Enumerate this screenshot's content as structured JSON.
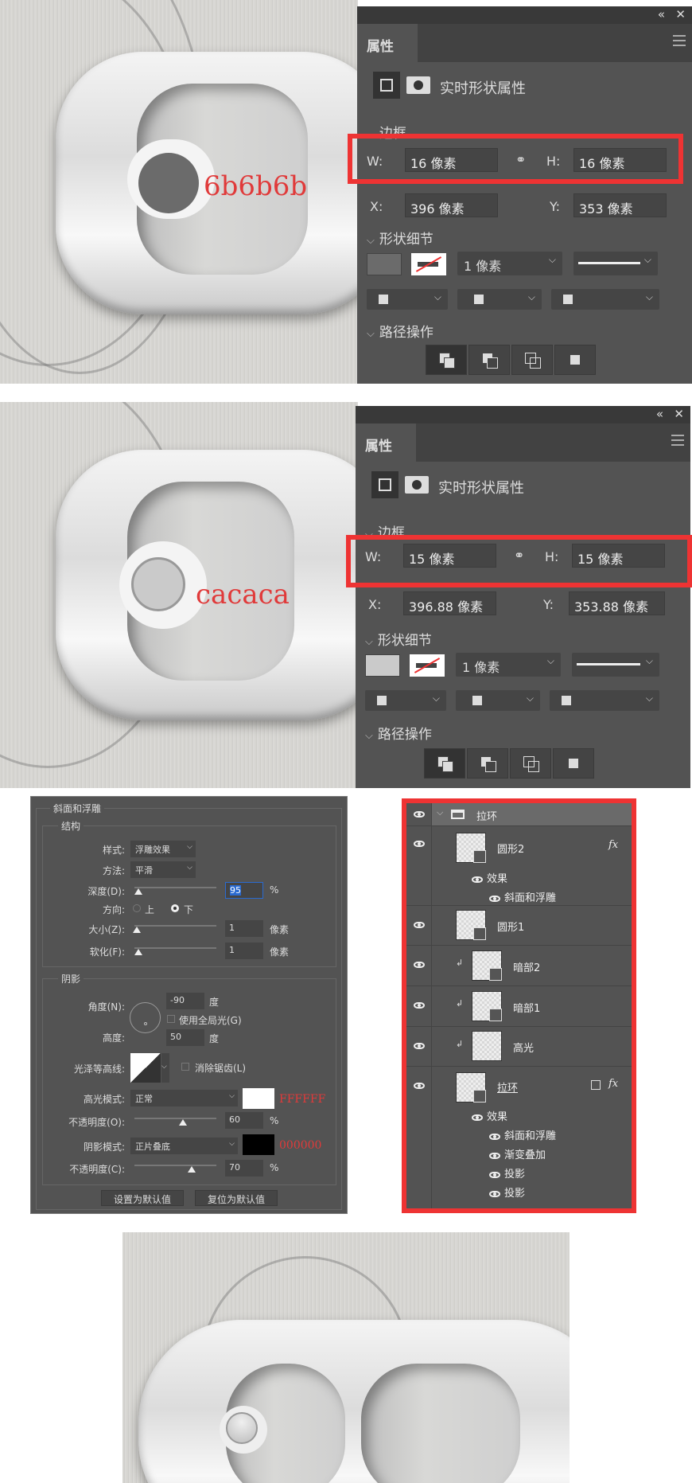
{
  "panel1": {
    "annotation": "6b6b6b",
    "circle_color": "#6b6b6b",
    "tab": "属性",
    "live_shape": "实时形状属性",
    "bounds_section": "边框",
    "w_label": "W:",
    "w_value": "16 像素",
    "h_label": "H:",
    "h_value": "16 像素",
    "x_label": "X:",
    "x_value": "396 像素",
    "y_label": "Y:",
    "y_value": "353 像素",
    "shape_section": "形状细节",
    "fill_color": "#6b6b6b",
    "stroke_width": "1 像素",
    "path_section": "路径操作"
  },
  "panel2": {
    "annotation": "cacaca",
    "circle_color": "#cacaca",
    "tab": "属性",
    "live_shape": "实时形状属性",
    "bounds_section": "边框",
    "w_label": "W:",
    "w_value": "15 像素",
    "h_label": "H:",
    "h_value": "15 像素",
    "x_label": "X:",
    "x_value": "396.88 像素",
    "y_label": "Y:",
    "y_value": "353.88 像素",
    "shape_section": "形状细节",
    "fill_color": "#cacaca",
    "stroke_width": "1 像素",
    "path_section": "路径操作"
  },
  "bevel": {
    "title": "斜面和浮雕",
    "structure": "结构",
    "style_label": "样式:",
    "style_value": "浮雕效果",
    "technique_label": "方法:",
    "technique_value": "平滑",
    "depth_label": "深度(D):",
    "depth_value": "95",
    "depth_unit": "%",
    "depth_pct": 5,
    "direction_label": "方向:",
    "dir_up": "上",
    "dir_down": "下",
    "direction_selected": "下",
    "size_label": "大小(Z):",
    "size_value": "1",
    "size_unit": "像素",
    "soften_label": "软化(F):",
    "soften_value": "1",
    "soften_unit": "像素",
    "shading": "阴影",
    "angle_label": "角度(N):",
    "angle_value": "-90",
    "angle_unit": "度",
    "global_light": "使用全局光(G)",
    "altitude_label": "高度:",
    "altitude_value": "50",
    "altitude_unit": "度",
    "gloss_label": "光泽等高线:",
    "antialias": "消除锯齿(L)",
    "highlight_label": "高光模式:",
    "highlight_value": "正常",
    "highlight_color": "#FFFFFF",
    "highlight_annot": "FFFFFF",
    "hl_opacity_label": "不透明度(O):",
    "hl_opacity_value": "60",
    "hl_unit": "%",
    "shadow_label": "阴影模式:",
    "shadow_value": "正片叠底",
    "shadow_color": "#000000",
    "shadow_annot": "000000",
    "sh_opacity_label": "不透明度(C):",
    "sh_opacity_value": "70",
    "sh_unit": "%",
    "make_default": "设置为默认值",
    "reset_default": "复位为默认值"
  },
  "layers": {
    "group": "拉环",
    "circle2": "圆形2",
    "fx": "fx",
    "effects": "效果",
    "bevel": "斜面和浮雕",
    "circle1": "圆形1",
    "dark2": "暗部2",
    "dark1": "暗部1",
    "highlight": "高光",
    "pulltab": "拉环",
    "gradient_overlay": "渐变叠加",
    "drop_shadow": "投影"
  }
}
